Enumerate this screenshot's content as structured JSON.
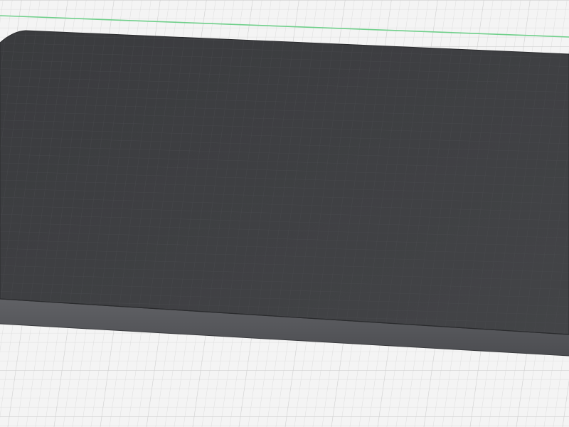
{
  "viewport": {
    "kind": "3d-modeling-viewport",
    "view": "perspective",
    "grid": {
      "visible": true,
      "background_color": "#f4f4f4",
      "minor_line_color": "#dedede",
      "major_line_color": "#cfcfcf"
    },
    "axis": {
      "visible": true,
      "color": "#6fcf8a"
    },
    "model": {
      "shape": "rectangular-slab",
      "top_color": "#3d3e41",
      "top_grid_color": "#4a4b4f",
      "front_face_color": "#55565a",
      "edge_color": "#2a2b2d"
    }
  }
}
